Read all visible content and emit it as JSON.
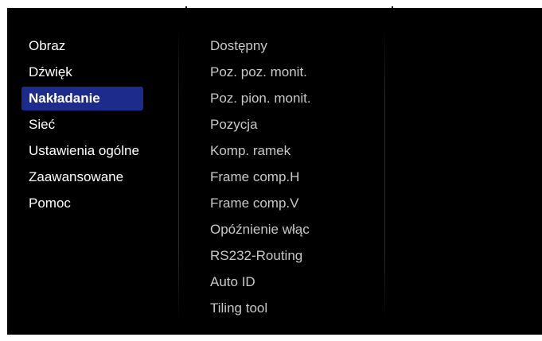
{
  "main_menu": {
    "items": [
      {
        "label": "Obraz"
      },
      {
        "label": "Dźwięk"
      },
      {
        "label": "Nakładanie",
        "selected": true
      },
      {
        "label": "Sieć"
      },
      {
        "label": "Ustawienia ogólne"
      },
      {
        "label": "Zaawansowane"
      },
      {
        "label": "Pomoc"
      }
    ]
  },
  "submenu": {
    "items": [
      {
        "label": "Dostępny"
      },
      {
        "label": "Poz. poz. monit."
      },
      {
        "label": "Poz. pion. monit."
      },
      {
        "label": "Pozycja"
      },
      {
        "label": "Komp. ramek"
      },
      {
        "label": "Frame comp.H"
      },
      {
        "label": "Frame comp.V"
      },
      {
        "label": "Opóźnienie włąc"
      },
      {
        "label": "RS232-Routing"
      },
      {
        "label": "Auto ID"
      },
      {
        "label": "Tiling tool"
      }
    ]
  },
  "colors": {
    "background": "#000000",
    "selected_highlight": "#1c2b8c",
    "main_text": "#ffffff",
    "submenu_text": "#c8c8c8"
  }
}
